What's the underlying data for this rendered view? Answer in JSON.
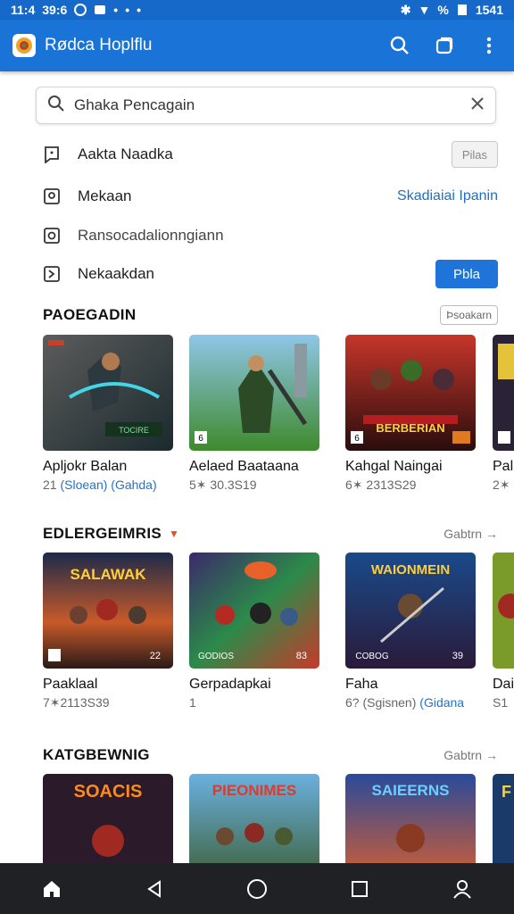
{
  "status_bar": {
    "time_left": "11:4",
    "left_text": "39:6",
    "battery": "%",
    "time_right": "1541"
  },
  "app_bar": {
    "title": "Rødca Hoplflu"
  },
  "search": {
    "value": "Ghaka Pencagain"
  },
  "menu": [
    {
      "label": "Aakta Naadka",
      "action": "Pilas"
    },
    {
      "label": "Mekaan",
      "action": "Skadiaiai Ipanin"
    },
    {
      "label": "Ransocadalionngiann"
    },
    {
      "label": "Nekaakdan",
      "action": "Pbla"
    }
  ],
  "sections": [
    {
      "title": "PAOEGADIN",
      "more": "Þsoakarn",
      "cards": [
        {
          "title": "Apljokr Balan",
          "sub_a": "21 ",
          "sub_hl": "(Sloean) (Gahda)",
          "thumb_caption": ""
        },
        {
          "title": "Aelaed Baataana",
          "sub_a": "5✶ 30.3S19",
          "sub_hl": "",
          "thumb_caption": ""
        },
        {
          "title": "Kahgal Naingai",
          "sub_a": "6✶ 2313S29",
          "sub_hl": "",
          "thumb_caption": "BERBERIAN"
        },
        {
          "title": "Pal",
          "sub_a": "2✶",
          "sub_hl": "",
          "thumb_caption": ""
        }
      ]
    },
    {
      "title": "EDLERGEIMRIS",
      "more": "Gabtrn →",
      "cards": [
        {
          "title": "Paaklaal",
          "sub_a": "7✶2113S39",
          "sub_hl": "",
          "thumb_caption": "SALAWAK",
          "badge": "22"
        },
        {
          "title": "Gerpadapkai",
          "sub_a": "1",
          "sub_hl": "",
          "thumb_caption": "",
          "badge": "83"
        },
        {
          "title": "Faha",
          "sub_a": "6? (Sgisnen) ",
          "sub_hl": "(Gidana",
          "thumb_caption": "WAIONMEIN",
          "badge": "39"
        },
        {
          "title": "Dai",
          "sub_a": "S1",
          "sub_hl": "",
          "thumb_caption": ""
        }
      ]
    },
    {
      "title": "KATGBEWNIG",
      "more": "Gabtrn →",
      "cards": [
        {
          "title": "",
          "sub_a": "",
          "sub_hl": "",
          "thumb_caption": "SOACIS"
        },
        {
          "title": "",
          "sub_a": "",
          "sub_hl": "",
          "thumb_caption": "PIEONIMES"
        },
        {
          "title": "",
          "sub_a": "",
          "sub_hl": "",
          "thumb_caption": "SAIEERNS"
        },
        {
          "title": "",
          "sub_a": "",
          "sub_hl": "",
          "thumb_caption": ""
        }
      ]
    }
  ],
  "colors": {
    "app_bar": "#1a73d6",
    "link": "#1f73c9",
    "nav_bar": "#202124"
  }
}
